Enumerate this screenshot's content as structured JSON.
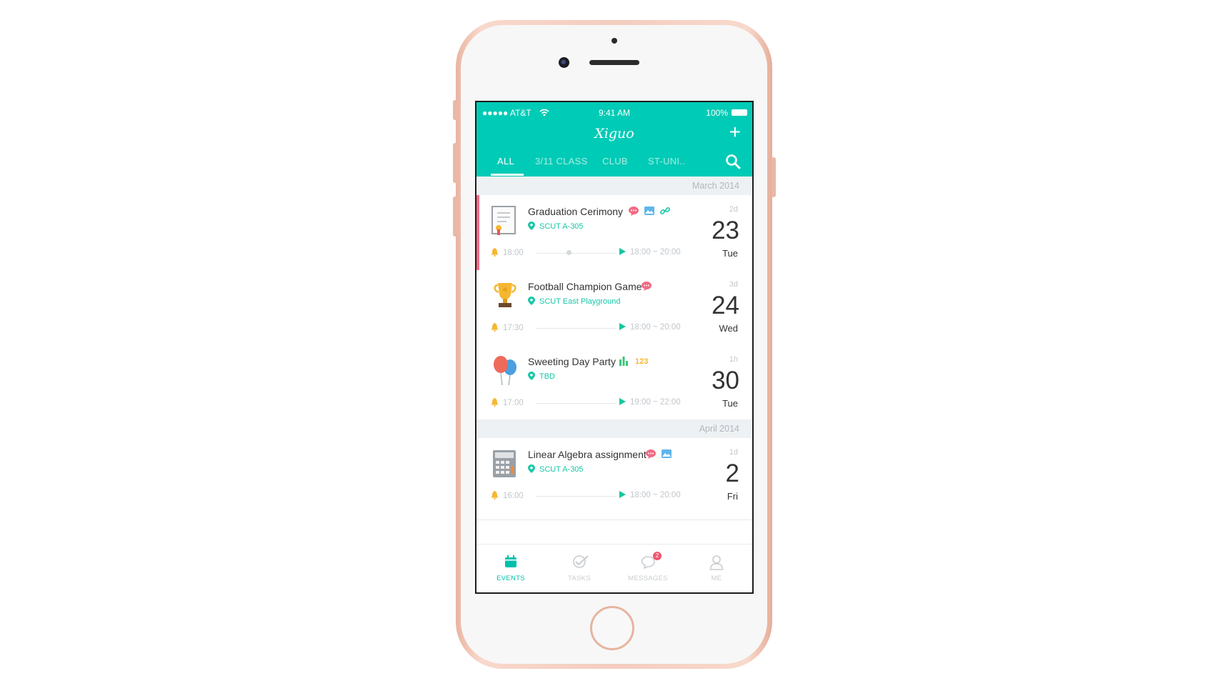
{
  "status_bar": {
    "carrier": "●●●●● AT&T",
    "time": "9:41 AM",
    "battery": "100%"
  },
  "app": {
    "title": "Xiguo",
    "add_icon": "plus-icon"
  },
  "tabs": [
    {
      "label": "ALL",
      "active": true
    },
    {
      "label": "3/11 CLASS",
      "active": false
    },
    {
      "label": "CLUB",
      "active": false
    },
    {
      "label": "ST-UNI..",
      "active": false
    }
  ],
  "sections": [
    {
      "month": "March 2014"
    },
    {
      "month": "April 2014"
    }
  ],
  "events": [
    {
      "title": "Graduation Cerimony",
      "location": "SCUT A-305",
      "reminder": "18:00",
      "time_range": "18:00 ~ 20:00",
      "ago": "2d",
      "day": "23",
      "weekday": "Tue",
      "icon": "certificate-icon",
      "badges": [
        "comment-icon",
        "image-icon",
        "link-icon"
      ]
    },
    {
      "title": "Football Champion Game",
      "location": "SCUT East Playground",
      "reminder": "17:30",
      "time_range": "18:00 ~ 20:00",
      "ago": "3d",
      "day": "24",
      "weekday": "Wed",
      "icon": "trophy-icon",
      "badges": [
        "comment-icon"
      ]
    },
    {
      "title": "Sweeting Day Party",
      "location": "TBD",
      "reminder": "17:00",
      "time_range": "19:00 ~ 22:00",
      "ago": "1h",
      "day": "30",
      "weekday": "Tue",
      "icon": "balloons-icon",
      "badges": [
        "poll-icon",
        "number-icon"
      ],
      "number_badge": "123"
    },
    {
      "title": "Linear Algebra assignment",
      "location": "SCUT A-305",
      "reminder": "16:00",
      "time_range": "18:00 ~ 20:00",
      "ago": "1d",
      "day": "2",
      "weekday": "Fri",
      "icon": "calculator-icon",
      "badges": [
        "comment-icon",
        "image-icon"
      ]
    }
  ],
  "tabbar": [
    {
      "label": "EVENTS",
      "icon": "calendar-icon",
      "active": true
    },
    {
      "label": "TASKS",
      "icon": "check-icon",
      "active": false
    },
    {
      "label": "MESSAGES",
      "icon": "chat-icon",
      "active": false,
      "badge": "2"
    },
    {
      "label": "ME",
      "icon": "person-icon",
      "active": false
    }
  ],
  "colors": {
    "accent": "#00cbb6",
    "highlight": "#f26b84",
    "location": "#17c7a8"
  }
}
